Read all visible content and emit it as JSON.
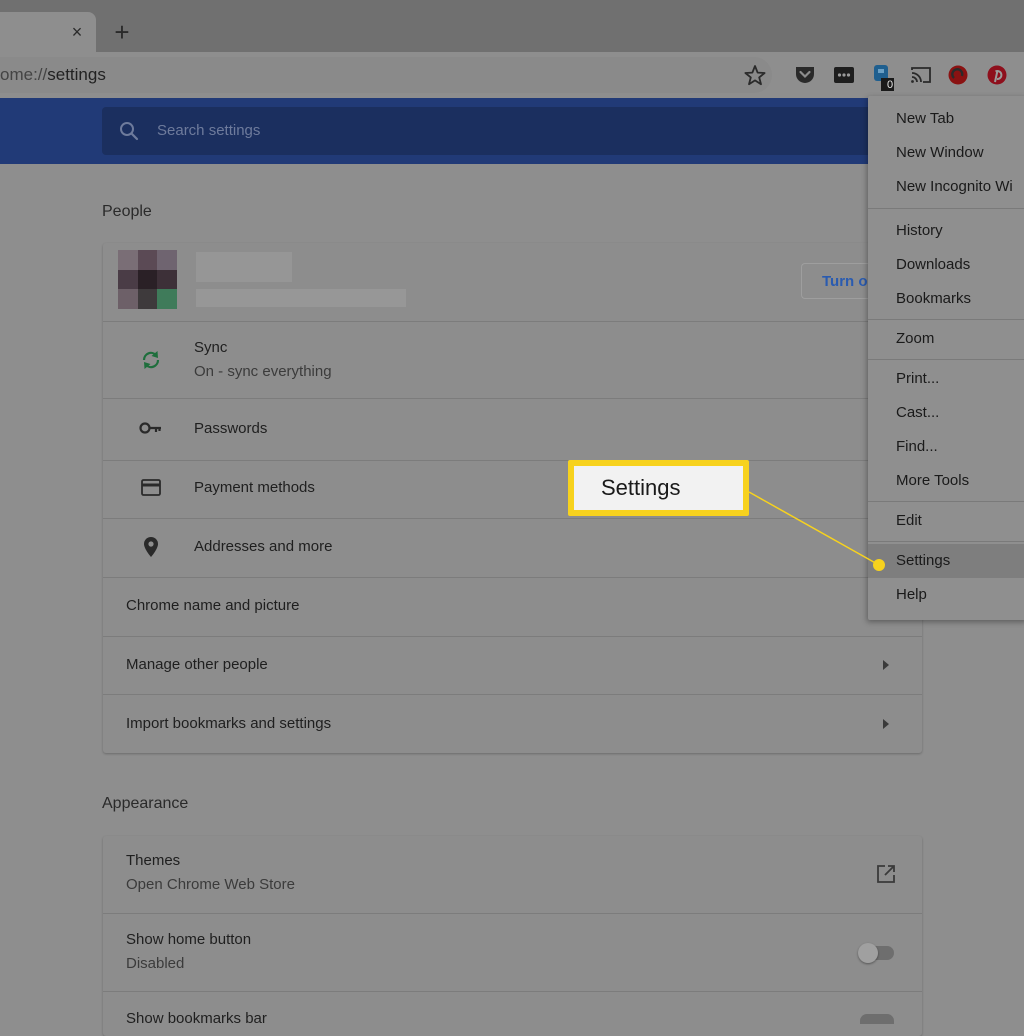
{
  "browser": {
    "tab_close": "×",
    "new_tab": "+",
    "url_scheme_partial": "ome://",
    "url_path": "settings",
    "extension_badge": "0"
  },
  "search": {
    "placeholder": "Search settings",
    "icon": "search-icon"
  },
  "people": {
    "title": "People",
    "turn_off_label": "Turn o",
    "sync": {
      "label": "Sync",
      "sub": "On - sync everything",
      "icon": "sync-icon"
    },
    "passwords": {
      "label": "Passwords",
      "icon": "key-icon"
    },
    "payment": {
      "label": "Payment methods",
      "icon": "credit-card-icon"
    },
    "addresses": {
      "label": "Addresses and more",
      "icon": "location-pin-icon"
    },
    "chrome_name": "Chrome name and picture",
    "manage_people": "Manage other people",
    "import": "Import bookmarks and settings"
  },
  "appearance": {
    "title": "Appearance",
    "themes": {
      "label": "Themes",
      "sub": "Open Chrome Web Store"
    },
    "home_button": {
      "label": "Show home button",
      "sub": "Disabled"
    },
    "bookmarks_bar": {
      "label": "Show bookmarks bar"
    }
  },
  "menu": {
    "new_tab": "New Tab",
    "new_window": "New Window",
    "new_incognito": "New Incognito Wi",
    "history": "History",
    "downloads": "Downloads",
    "bookmarks": "Bookmarks",
    "zoom": "Zoom",
    "print": "Print...",
    "cast": "Cast...",
    "find": "Find...",
    "more_tools": "More Tools",
    "edit": "Edit",
    "settings": "Settings",
    "help": "Help"
  },
  "callout": {
    "text": "Settings"
  },
  "colors": {
    "header": "#213a77",
    "accent_link": "#2a5bb0",
    "sync_green": "#1e6e3c",
    "callout_border": "#f7d21e"
  }
}
